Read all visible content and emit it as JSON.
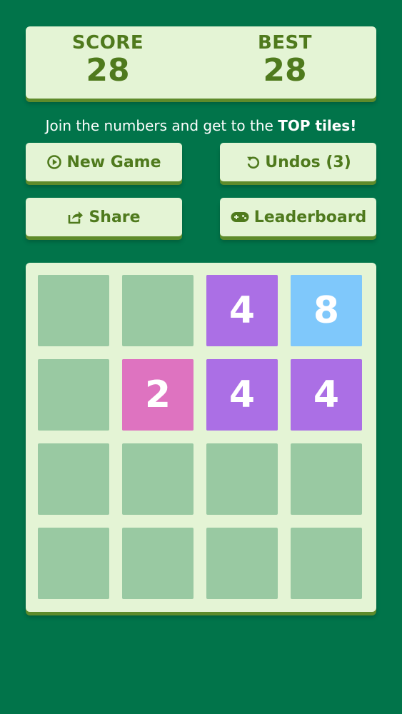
{
  "score": {
    "label": "SCORE",
    "value": "28"
  },
  "best": {
    "label": "BEST",
    "value": "28"
  },
  "tagline": {
    "prefix": "Join the numbers and get to the ",
    "bold": "TOP tiles!"
  },
  "buttons": {
    "new_game": "New Game",
    "undo": "Undos (3)",
    "share": "Share",
    "leaderboard": "Leaderboard"
  },
  "icons": {
    "new_game": "play-circle-icon",
    "undo": "undo-icon",
    "share": "share-icon",
    "leaderboard": "gamepad-icon"
  },
  "colors": {
    "background": "#01744a",
    "panel": "#e4f4d5",
    "text": "#4f7a1d",
    "empty_cell": "#99c9a2",
    "tile_2": "#de73c0",
    "tile_4": "#ab6fe5",
    "tile_8": "#7fc8fb"
  },
  "board": {
    "size": 4,
    "tiles": [
      {
        "row": 0,
        "col": 2,
        "value": "4",
        "color": "#ab6fe5"
      },
      {
        "row": 0,
        "col": 3,
        "value": "8",
        "color": "#7fc8fb"
      },
      {
        "row": 1,
        "col": 1,
        "value": "2",
        "color": "#de73c0"
      },
      {
        "row": 1,
        "col": 2,
        "value": "4",
        "color": "#ab6fe5"
      },
      {
        "row": 1,
        "col": 3,
        "value": "4",
        "color": "#ab6fe5"
      }
    ]
  }
}
